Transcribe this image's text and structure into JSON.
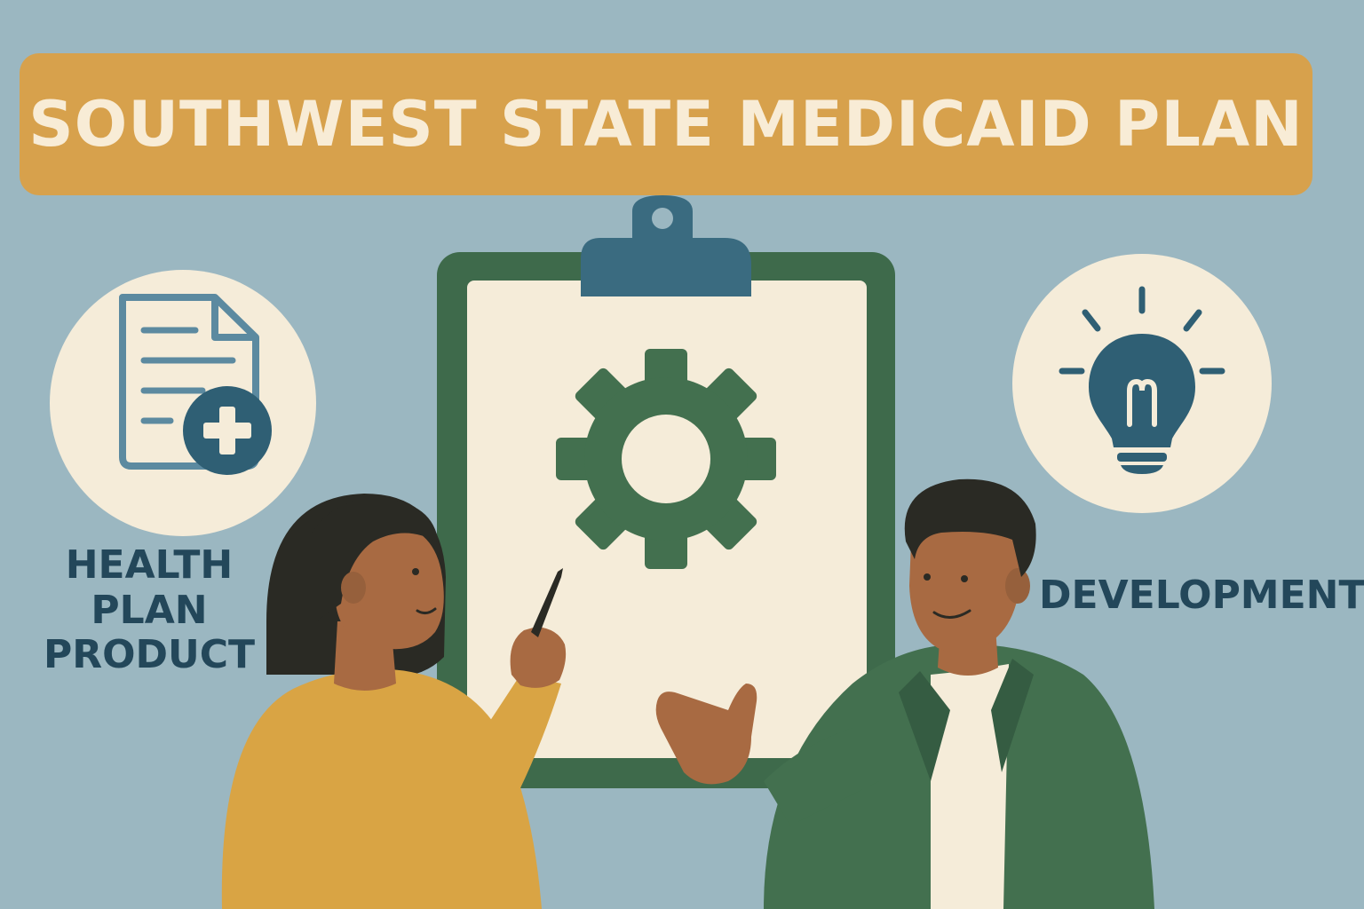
{
  "title": "SOUTHWEST STATE MEDICAID PLAN",
  "labels": {
    "left_line1": "HEALTH PLAN",
    "left_line2": "PRODUCT",
    "right": "DEVELOPMENT"
  },
  "icons": {
    "left_circle": "document-plus-icon",
    "center": "gear-icon",
    "right_circle": "lightbulb-icon"
  },
  "colors": {
    "background": "#9bb7c1",
    "banner": "#d7a14c",
    "banner_text": "#f8ecd6",
    "label_text": "#23475a",
    "clipboard_frame": "#3e6a4b",
    "paper": "#f5ecd9",
    "teal": "#3a6b80",
    "green": "#43704f",
    "mustard": "#d9a444",
    "skin": "#a86a42",
    "hair": "#2a2a24"
  }
}
